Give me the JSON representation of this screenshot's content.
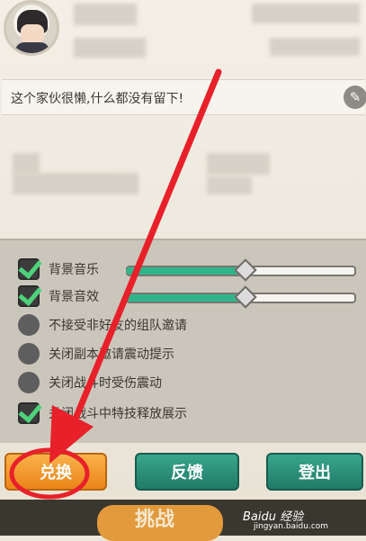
{
  "profile": {
    "signature": "这个家伙很懒,什么都没有留下!"
  },
  "settings": {
    "items": [
      {
        "label": "背景音乐",
        "checked": true,
        "volume_percent": 52
      },
      {
        "label": "背景音效",
        "checked": true,
        "volume_percent": 52
      },
      {
        "label": "不接受非好友的组队邀请",
        "checked": false
      },
      {
        "label": "关闭副本邀请震动提示",
        "checked": false
      },
      {
        "label": "关闭战斗时受伤震动",
        "checked": false
      },
      {
        "label": "关闭战斗中特技释放展示",
        "checked": true
      }
    ]
  },
  "buttons": {
    "exchange": "兑换",
    "feedback": "反馈",
    "logout": "登出"
  },
  "bottom": {
    "challenge": "挑战"
  },
  "watermark": {
    "brand": "Baidu 经验",
    "url": "jingyan.baidu.com"
  },
  "colors": {
    "accent_orange": "#ec8418",
    "accent_green": "#1f7b67",
    "slider_fill": "#2fb58b",
    "annotation_red": "#e8202a"
  }
}
